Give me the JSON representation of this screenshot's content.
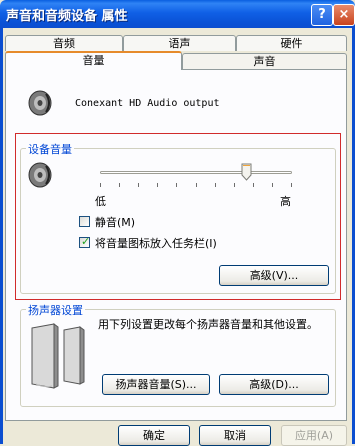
{
  "window": {
    "title": "声音和音频设备 属性",
    "help": "?",
    "close": "×"
  },
  "tabs": {
    "row1": [
      "音频",
      "语声",
      "硬件"
    ],
    "row2": [
      "音量",
      "声音"
    ],
    "active": "音量"
  },
  "device": {
    "name": "Conexant HD Audio output"
  },
  "device_volume": {
    "group_label": "设备音量",
    "slider_min_label": "低",
    "slider_max_label": "高",
    "level": 0.78,
    "mute_label": "静音(M)",
    "mute_checked": false,
    "tray_label": "将音量图标放入任务栏(I)",
    "tray_checked": true,
    "advanced_button": "高级(V)..."
  },
  "speakers": {
    "group_label": "扬声器设置",
    "description": "用下列设置更改每个扬声器音量和其他设置。",
    "volume_button": "扬声器音量(S)...",
    "advanced_button": "高级(D)..."
  },
  "footer": {
    "ok": "确定",
    "cancel": "取消",
    "apply": "应用(A)"
  },
  "colors": {
    "titlebar": "#0a52d6",
    "highlight": "#d12b2b",
    "group_label": "#0046d5"
  }
}
